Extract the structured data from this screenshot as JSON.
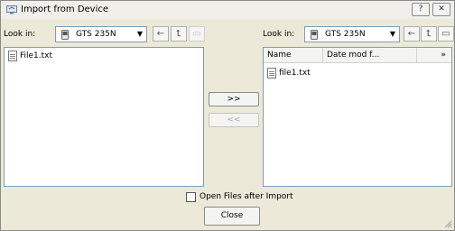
{
  "window": {
    "title": "Import from Device",
    "help_label": "?",
    "close_label": "✕"
  },
  "left": {
    "look_in_label": "Look in:",
    "location": "GTS 235N",
    "files": [
      "File1.txt"
    ]
  },
  "right": {
    "look_in_label": "Look in:",
    "location": "GTS 235N",
    "columns": [
      "Name",
      "Date mod f...",
      "»"
    ],
    "files": [
      "file1.txt"
    ]
  },
  "transfer": {
    "to_right_label": ">>",
    "to_left_label": "<<"
  },
  "footer": {
    "open_files_label": "Open Files after Import",
    "open_files_checked": false,
    "close_label": "Close"
  }
}
